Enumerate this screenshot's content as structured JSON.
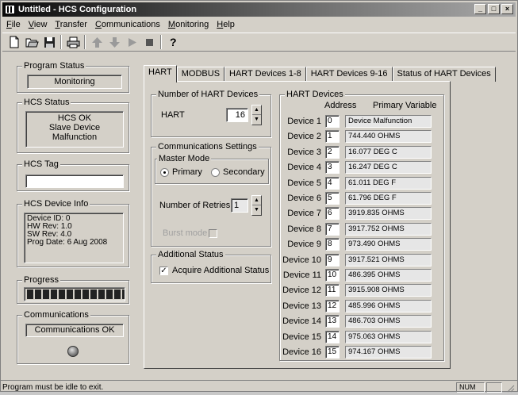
{
  "window": {
    "title": "Untitled - HCS Configuration",
    "buttons": [
      "_",
      "□",
      "×"
    ]
  },
  "menu": [
    {
      "label": "File",
      "u": "F",
      "rest": "ile"
    },
    {
      "label": "View",
      "u": "V",
      "rest": "iew"
    },
    {
      "label": "Transfer",
      "u": "T",
      "rest": "ransfer"
    },
    {
      "label": "Communications",
      "u": "C",
      "rest": "ommunications"
    },
    {
      "label": "Monitoring",
      "u": "M",
      "rest": "onitoring"
    },
    {
      "label": "Help",
      "u": "H",
      "rest": "elp"
    }
  ],
  "toolbar": [
    "new-icon",
    "open-icon",
    "save-icon",
    "print-icon",
    "upload-icon",
    "download-icon",
    "play-icon",
    "stop-icon",
    "help-icon"
  ],
  "left": {
    "program_status": {
      "title": "Program Status",
      "value": "Monitoring"
    },
    "hcs_status": {
      "title": "HCS Status",
      "line1": "HCS OK",
      "line2": "Slave Device Malfunction"
    },
    "hcs_tag": {
      "title": "HCS Tag",
      "value": ""
    },
    "device_info": {
      "title": "HCS Device Info",
      "lines": [
        "Device ID: 0",
        "HW Rev: 1.0",
        "SW Rev: 4.0",
        "Prog Date: 6 Aug 2008"
      ]
    },
    "progress": {
      "title": "Progress",
      "fraction": 1.0,
      "segments": 15
    },
    "communications": {
      "title": "Communications",
      "value": "Communications OK"
    }
  },
  "tabs": [
    "HART",
    "MODBUS",
    "HART Devices 1-8",
    "HART Devices 9-16",
    "Status of HART Devices"
  ],
  "hart": {
    "num_devices": {
      "title": "Number of HART Devices",
      "label": "HART",
      "value": "16"
    },
    "comm": {
      "title": "Communications Settings",
      "master_mode": "Master Mode",
      "primary": "Primary",
      "secondary": "Secondary",
      "retries_label": "Number of Retries",
      "retries_value": "1",
      "burst_label": "Burst mode"
    },
    "additional": {
      "title": "Additional Status",
      "label": "Acquire Additional Status"
    },
    "devices": {
      "title": "HART Devices",
      "col_address": "Address",
      "col_pv": "Primary Variable",
      "rows": [
        {
          "name": "Device 1",
          "addr": "0",
          "pv": "Device Malfunction"
        },
        {
          "name": "Device 2",
          "addr": "1",
          "pv": "744.440 OHMS"
        },
        {
          "name": "Device 3",
          "addr": "2",
          "pv": "16.077 DEG C"
        },
        {
          "name": "Device 4",
          "addr": "3",
          "pv": "16.247 DEG C"
        },
        {
          "name": "Device 5",
          "addr": "4",
          "pv": "61.011 DEG F"
        },
        {
          "name": "Device 6",
          "addr": "5",
          "pv": "61.796 DEG F"
        },
        {
          "name": "Device 7",
          "addr": "6",
          "pv": "3919.835 OHMS"
        },
        {
          "name": "Device 8",
          "addr": "7",
          "pv": "3917.752 OHMS"
        },
        {
          "name": "Device 9",
          "addr": "8",
          "pv": "973.490 OHMS"
        },
        {
          "name": "Device 10",
          "addr": "9",
          "pv": "3917.521 OHMS"
        },
        {
          "name": "Device 11",
          "addr": "10",
          "pv": "486.395 OHMS"
        },
        {
          "name": "Device 12",
          "addr": "11",
          "pv": "3915.908 OHMS"
        },
        {
          "name": "Device 13",
          "addr": "12",
          "pv": "485.996 OHMS"
        },
        {
          "name": "Device 14",
          "addr": "13",
          "pv": "486.703 OHMS"
        },
        {
          "name": "Device 15",
          "addr": "14",
          "pv": "975.063 OHMS"
        },
        {
          "name": "Device 16",
          "addr": "15",
          "pv": "974.167 OHMS"
        }
      ]
    }
  },
  "statusbar": {
    "message": "Program must be idle to exit.",
    "num": "NUM"
  }
}
